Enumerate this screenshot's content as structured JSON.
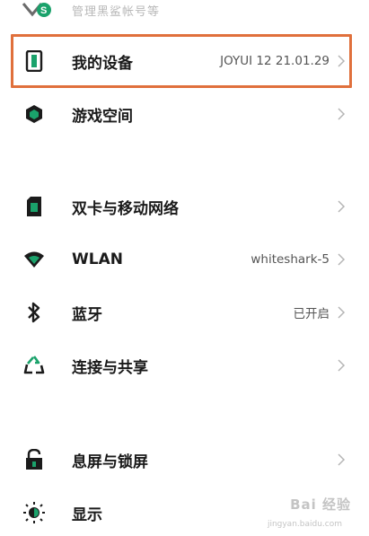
{
  "top_partial": {
    "text": "管理黑鲨帐号等",
    "icon": "account-icon"
  },
  "rows": [
    {
      "label": "我的设备",
      "value": "JOYUI 12 21.01.29",
      "icon": "phone-icon"
    },
    {
      "label": "游戏空间",
      "value": "",
      "icon": "game-cube-icon"
    },
    {
      "label": "双卡与移动网络",
      "value": "",
      "icon": "sim-card-icon"
    },
    {
      "label": "WLAN",
      "value": "whiteshark-5",
      "icon": "wifi-icon"
    },
    {
      "label": "蓝牙",
      "value": "已开启",
      "icon": "bluetooth-icon"
    },
    {
      "label": "连接与共享",
      "value": "",
      "icon": "share-icon"
    },
    {
      "label": "息屏与锁屏",
      "value": "",
      "icon": "lock-icon"
    },
    {
      "label": "显示",
      "value": "",
      "icon": "brightness-icon"
    }
  ],
  "watermark": {
    "brand": "Bai 经验",
    "sub": "jingyan.baidu.com"
  },
  "colors": {
    "accent": "#1aa26b",
    "highlight": "#e0703c",
    "icon_dark": "#1b1b1b"
  }
}
